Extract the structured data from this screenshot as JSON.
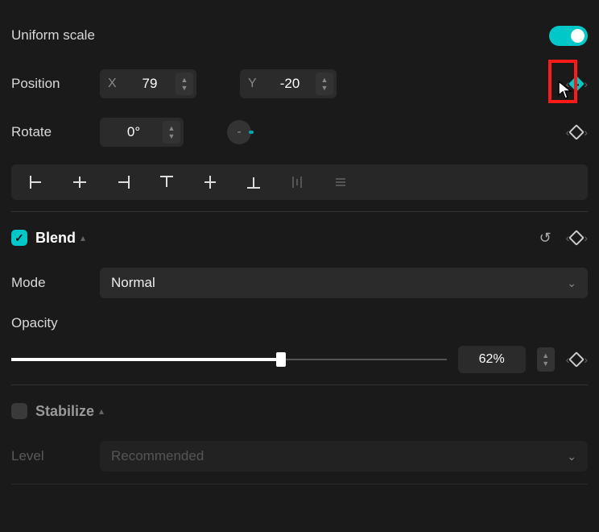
{
  "uniform_scale": {
    "label": "Uniform scale",
    "on": true
  },
  "position": {
    "label": "Position",
    "x_label": "X",
    "x_value": "79",
    "y_label": "Y",
    "y_value": "-20"
  },
  "rotate": {
    "label": "Rotate",
    "value": "0°"
  },
  "align": {
    "items": [
      "align-left",
      "align-center-h",
      "align-right",
      "align-top",
      "align-center-v",
      "align-bottom",
      "distribute-h",
      "distribute-v"
    ]
  },
  "blend": {
    "title": "Blend",
    "checked": true,
    "mode_label": "Mode",
    "mode_value": "Normal",
    "opacity_label": "Opacity",
    "opacity_value": "62%",
    "opacity_pct": 62
  },
  "stabilize": {
    "title": "Stabilize",
    "checked": false,
    "level_label": "Level",
    "level_value": "Recommended"
  }
}
